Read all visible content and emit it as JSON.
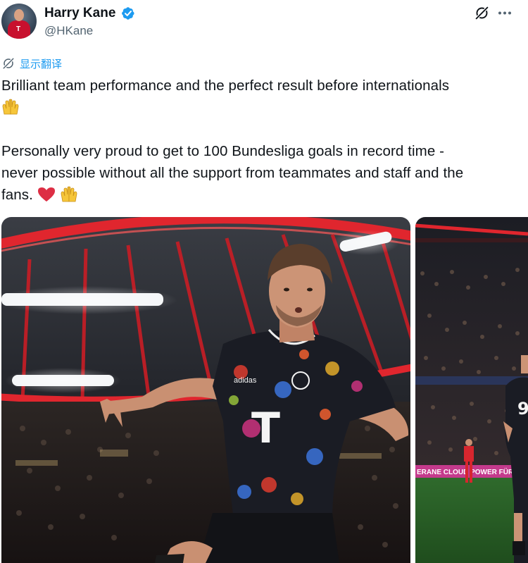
{
  "author": {
    "name": "Harry Kane",
    "handle": "@HKane",
    "avatar_icon": "avatar-photo",
    "verified_icon": "verified-badge-icon",
    "verified_color": "#1d9bf0"
  },
  "header_actions": {
    "grok_icon": "grok-icon",
    "more_icon": "more-icon"
  },
  "translate": {
    "label": "显示翻译",
    "icon": "translate-icon",
    "color": "#1d9bf0"
  },
  "tweet": {
    "line1": "Brilliant team performance and the perfect result before internationals",
    "line3": "Personally very proud to get to 100 Bundesliga goals in record time -",
    "line4": "never possible without all the support from teammates and staff and the",
    "line5": "fans.",
    "emojis": [
      "raising-hands-emoji",
      "red-heart-emoji",
      "raising-hands-emoji"
    ]
  },
  "media": {
    "photo1": {
      "shirt_sponsor": "T",
      "shirt_brand": "adidas"
    },
    "photo2": {
      "board_text": "ERANE CLOUD POWER FÜR",
      "shirt_number": "9"
    }
  },
  "colors": {
    "text": "#0f1419",
    "secondary": "#536471",
    "accent": "#1d9bf0"
  }
}
